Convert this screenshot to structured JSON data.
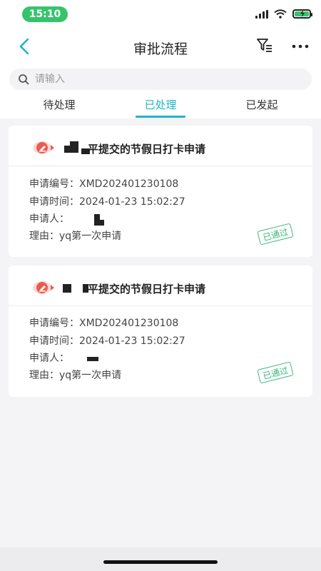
{
  "status_bar": {
    "time": "15:10"
  },
  "navbar": {
    "title": "审批流程"
  },
  "search": {
    "placeholder": "请输入"
  },
  "tabs": [
    {
      "label": "待处理",
      "active": false
    },
    {
      "label": "已处理",
      "active": true
    },
    {
      "label": "已发起",
      "active": false
    }
  ],
  "colors": {
    "accent": "#1fb5c4",
    "approved": "#3db57a",
    "stamp_red": "#ec5b4f"
  },
  "cards": [
    {
      "title": "平提交的节假日打卡申请",
      "no_label": "申请编号：",
      "no_value": "XMD202401230108",
      "time_label": "申请时间：",
      "time_value": "2024-01-23 15:02:27",
      "applicant_label": "申请人：",
      "reason_label": "理由：",
      "reason_value": "yq第一次申请",
      "status": "已通过"
    },
    {
      "title": "平提交的节假日打卡申请",
      "no_label": "申请编号：",
      "no_value": "XMD202401230108",
      "time_label": "申请时间：",
      "time_value": "2024-01-23 15:02:27",
      "applicant_label": "申请人：",
      "reason_label": "理由：",
      "reason_value": "yq第一次申请",
      "status": "已通过"
    }
  ]
}
